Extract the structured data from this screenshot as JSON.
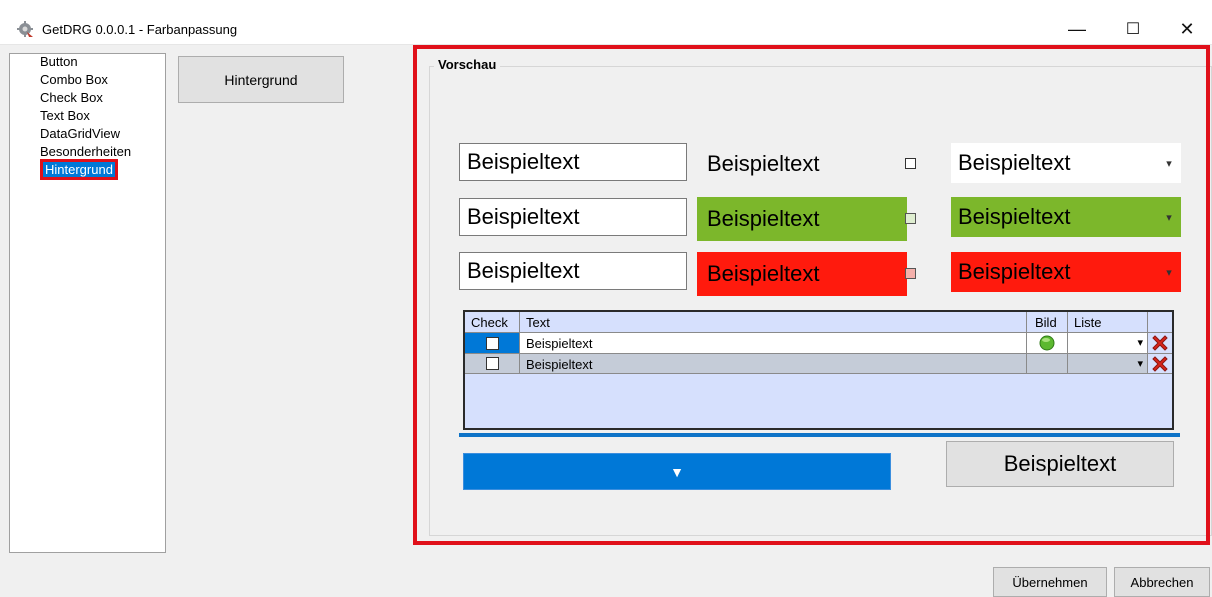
{
  "window": {
    "title": "GetDRG 0.0.0.1 - Farbanpassung",
    "minimize_glyph": "—",
    "maximize_glyph": "☐",
    "close_glyph": "✕"
  },
  "sidebar": {
    "items": [
      {
        "label": "Button"
      },
      {
        "label": "Combo Box"
      },
      {
        "label": "Check Box"
      },
      {
        "label": "Text Box"
      },
      {
        "label": "DataGridView"
      },
      {
        "label": "Besonderheiten"
      },
      {
        "label": "Hintergrund",
        "selected": true
      }
    ]
  },
  "color_button": {
    "label": "Hintergrund"
  },
  "preview": {
    "group_label": "Vorschau",
    "rows": [
      {
        "textbox": "Beispieltext",
        "label": "Beispieltext",
        "label_bg": "transparent",
        "combo": "Beispieltext",
        "combo_bg": "#ffffff"
      },
      {
        "textbox": "Beispieltext",
        "label": "Beispieltext",
        "label_bg": "#7cb72b",
        "combo": "Beispieltext",
        "combo_bg": "#7cb72b"
      },
      {
        "textbox": "Beispieltext",
        "label": "Beispieltext",
        "label_bg": "#ff1a0d",
        "combo": "Beispieltext",
        "combo_bg": "#ff1a0d"
      }
    ],
    "grid": {
      "headers": [
        "Check",
        "Text",
        "Bild",
        "Liste"
      ],
      "rows": [
        {
          "text": "Beispieltext",
          "has_image": true
        },
        {
          "text": "Beispieltext",
          "has_image": false
        }
      ]
    },
    "dropdown_glyph": "▼",
    "button_label": "Beispieltext"
  },
  "footer": {
    "apply_label": "Übernehmen",
    "cancel_label": "Abbrechen"
  },
  "colors": {
    "selection_blue": "#0078d7",
    "highlight_red": "#e0101a",
    "green": "#7cb72b",
    "red": "#ff1a0d",
    "grid_bg": "#d6e0fd"
  }
}
